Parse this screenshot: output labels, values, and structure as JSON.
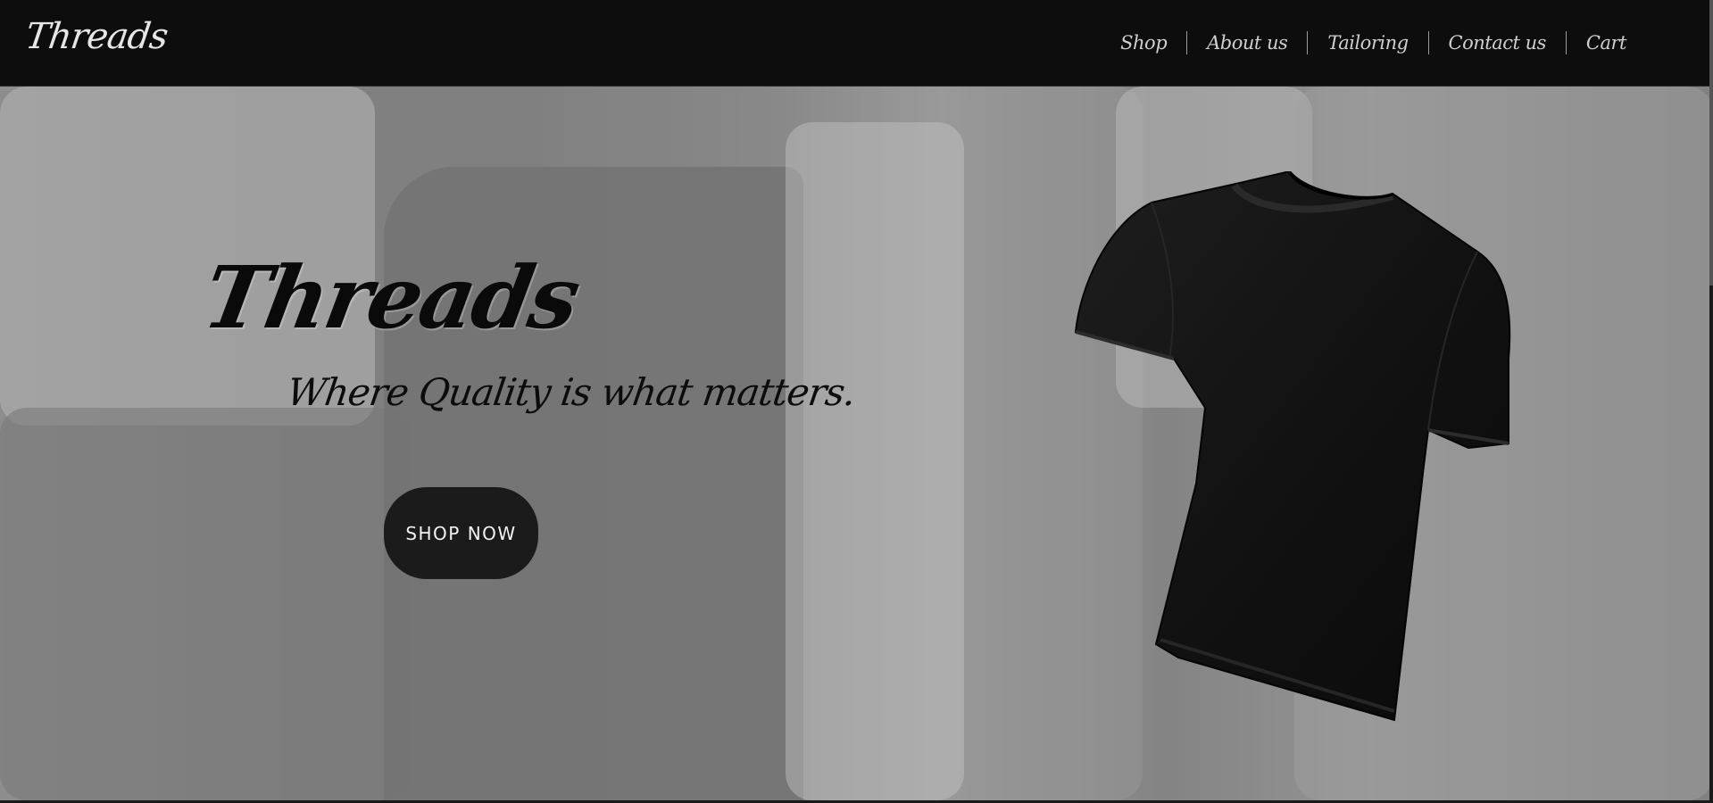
{
  "brand": {
    "name": "Threads"
  },
  "nav": {
    "items": [
      {
        "label": "Shop"
      },
      {
        "label": "About us"
      },
      {
        "label": "Tailoring"
      },
      {
        "label": "Contact us"
      },
      {
        "label": "Cart"
      }
    ]
  },
  "hero": {
    "title": "Threads",
    "tagline": "Where Quality is what matters.",
    "cta_label": "SHOP NOW",
    "image": "black-tshirt"
  },
  "colors": {
    "navbar": "#0d0d0d",
    "button": "#1b1b1b",
    "nav_text": "#cfcfcf"
  }
}
